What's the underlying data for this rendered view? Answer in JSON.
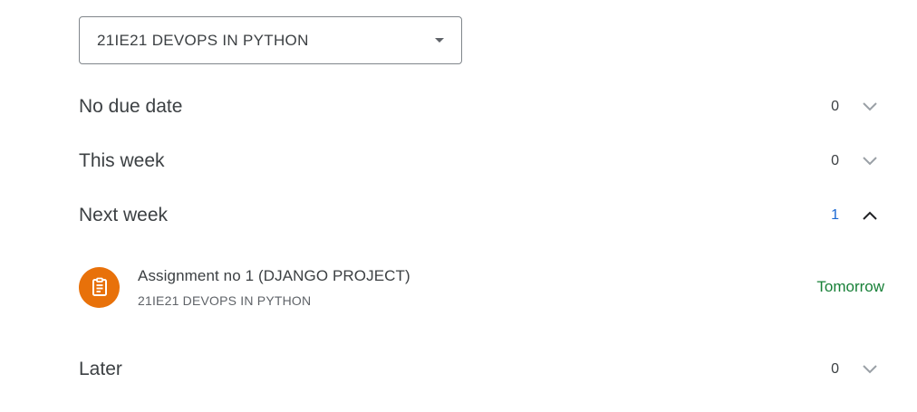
{
  "class_filter": {
    "selected": "21IE21 DEVOPS IN PYTHON",
    "icon": "arrow-drop-down"
  },
  "sections": [
    {
      "id": "no-due-date",
      "title": "No due date",
      "count": "0",
      "expanded": false
    },
    {
      "id": "this-week",
      "title": "This week",
      "count": "0",
      "expanded": false
    },
    {
      "id": "next-week",
      "title": "Next week",
      "count": "1",
      "expanded": true
    },
    {
      "id": "later",
      "title": "Later",
      "count": "0",
      "expanded": false
    }
  ],
  "next_week_items": [
    {
      "title": "Assignment no 1 (DJANGO PROJECT)",
      "class_name": "21IE21 DEVOPS IN PYTHON",
      "due": "Tomorrow",
      "icon": "assignment-icon"
    }
  ],
  "colors": {
    "assignment_icon_bg": "#e8710a",
    "due_text": "#188038",
    "active_count": "#1967d2"
  }
}
